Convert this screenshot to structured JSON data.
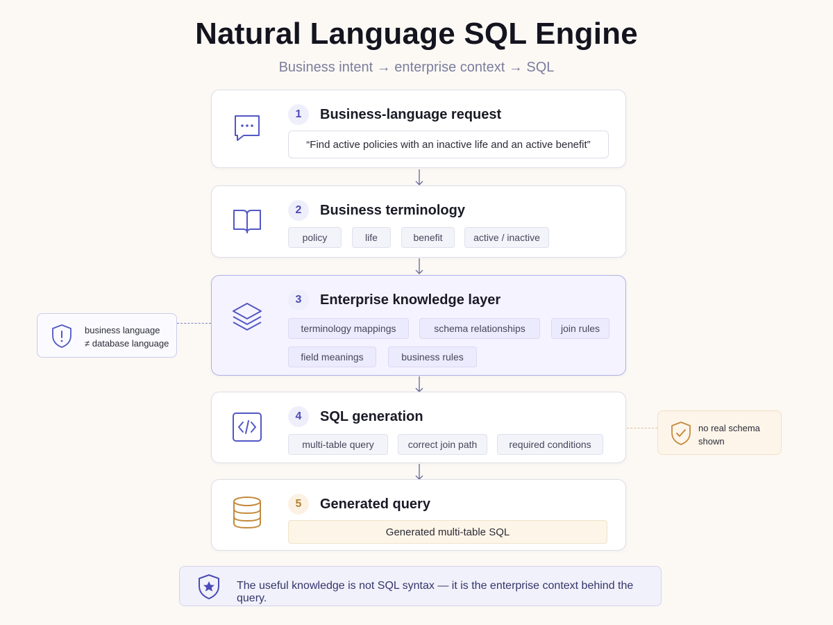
{
  "title": "Natural Language SQL Engine",
  "subtitle": "Business intent → enterprise context → SQL",
  "steps": [
    {
      "number": "1",
      "title": "Business-language request",
      "icon": "chat-bubble-icon",
      "quote": "“Find active policies with an inactive life and an active benefit”"
    },
    {
      "number": "2",
      "title": "Business terminology",
      "icon": "book-icon",
      "chips": [
        "policy",
        "life",
        "benefit",
        "active / inactive"
      ]
    },
    {
      "number": "3",
      "title": "Enterprise knowledge layer",
      "icon": "layers-icon",
      "chips": [
        "terminology mappings",
        "schema relationships",
        "join rules",
        "field meanings",
        "business rules"
      ]
    },
    {
      "number": "4",
      "title": "SQL generation",
      "icon": "code-icon",
      "chips": [
        "multi-table query",
        "correct join path",
        "required conditions"
      ]
    },
    {
      "number": "5",
      "title": "Generated query",
      "icon": "database-icon",
      "output": "Generated multi-table SQL"
    }
  ],
  "side_notes": {
    "left": {
      "icon": "shield-alert-icon",
      "line1": "business language",
      "line2": "≠ database language"
    },
    "right": {
      "icon": "shield-check-icon",
      "line1": "no real schema",
      "line2": "shown"
    }
  },
  "footer": {
    "icon": "shield-star-icon",
    "text": "The useful knowledge is not SQL syntax — it is the enterprise context behind the query."
  },
  "colors": {
    "accent": "#4b4bb8",
    "gold": "#b5802f",
    "background": "#fcf9f5",
    "highlight_card": "#f5f3ff"
  }
}
